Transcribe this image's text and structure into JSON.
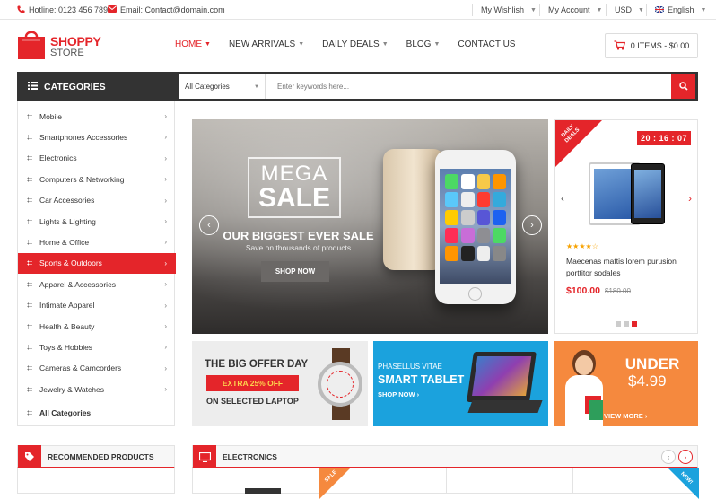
{
  "topbar": {
    "hotline": "Hotline: 0123 456 7891",
    "email": "Email: Contact@domain.com",
    "wishlist": "My Wishlish",
    "account": "My Account",
    "currency": "USD",
    "language": "English"
  },
  "logo": {
    "line1": "SHOPPY",
    "line2": "STORE"
  },
  "nav": {
    "items": [
      "HOME",
      "NEW ARRIVALS",
      "DAILY DEALS",
      "BLOG",
      "CONTACT US"
    ]
  },
  "cart": {
    "label": "0 ITEMS - $0.00"
  },
  "categories_bar": {
    "title": "CATEGORIES"
  },
  "search": {
    "category": "All Categories",
    "placeholder": "Enter keywords here..."
  },
  "sidebar": {
    "items": [
      "Mobile",
      "Smartphones Accessories",
      "Electronics",
      "Computers & Networking",
      "Car Accessories",
      "Lights & Lighting",
      "Home & Office",
      "Sports & Outdoors",
      "Apparel & Accessories",
      "Intimate Apparel",
      "Health & Beauty",
      "Toys & Hobbies",
      "Cameras & Camcorders",
      "Jewelry & Watches"
    ],
    "all": "All Categories",
    "active_index": 7
  },
  "hero": {
    "mega": "MEGA",
    "sale": "SALE",
    "headline": "OUR BIGGEST EVER SALE",
    "sub": "Save on thousands of products",
    "cta": "SHOP NOW"
  },
  "deal": {
    "ribbon": "DAILY DEALS",
    "timer": "20 : 16 : 07",
    "stars": "★★★★☆",
    "rating": 4,
    "name": "Maecenas mattis lorem purusion porttitor sodales",
    "price": "$100.00",
    "old_price": "$180.00"
  },
  "banners": {
    "b1": {
      "t1": "THE BIG OFFER DAY",
      "t2": "EXTRA 25% OFF",
      "t3": "ON SELECTED LAPTOP"
    },
    "b2": {
      "t1": "PHASELLUS VITAE",
      "t2": "SMART TABLET",
      "t3": "SHOP NOW ›"
    },
    "b3": {
      "t1": "UNDER",
      "t2": "$4.99",
      "t3": "VIEW MORE ›"
    }
  },
  "sections": {
    "recommended": "RECOMMENDED PRODUCTS",
    "electronics": "ELECTRONICS",
    "sale_badge": "SALE",
    "new_badge": "NEW!"
  },
  "colors": {
    "accent": "#e4252a",
    "dark": "#333333",
    "blue": "#1ba2dd",
    "orange": "#f5893e"
  }
}
